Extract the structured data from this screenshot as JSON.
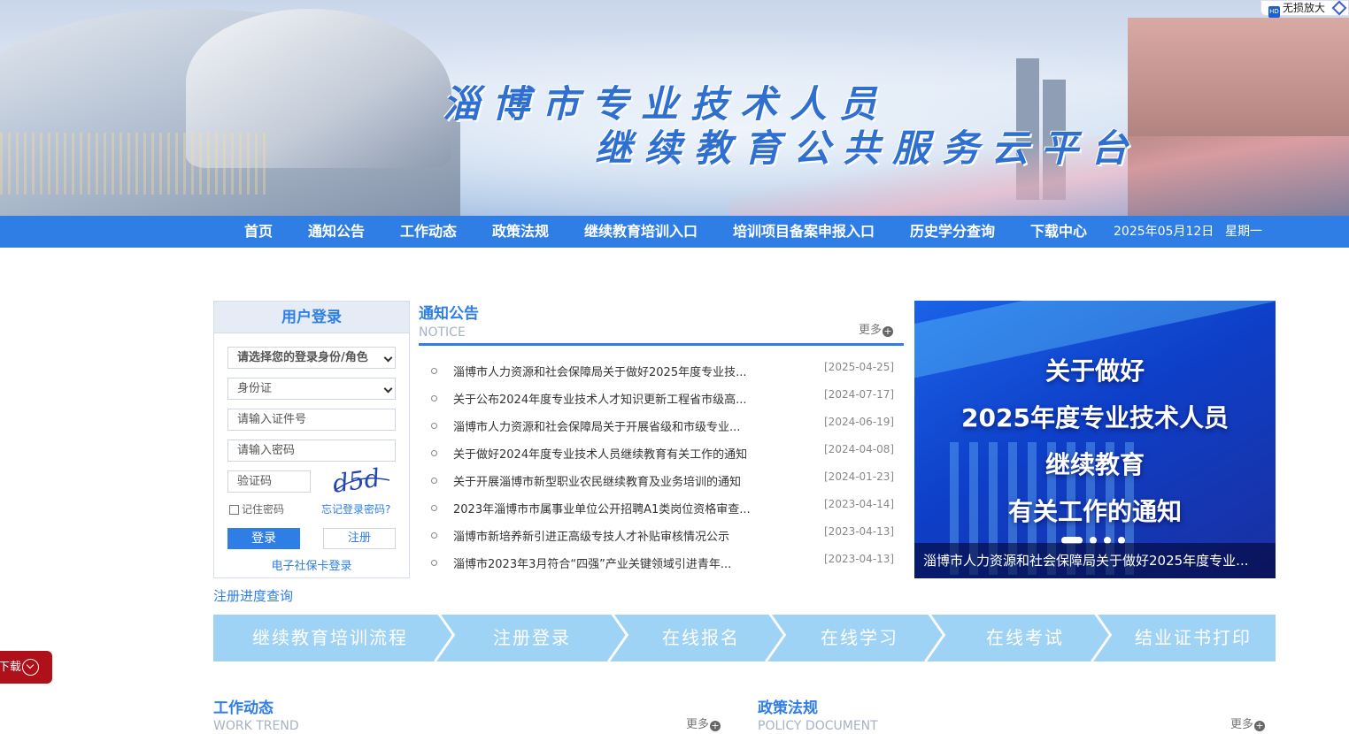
{
  "banner": {
    "title_line1": "淄博市专业技术人员",
    "title_line2": "继续教育公共服务云平台"
  },
  "browser_chip": {
    "icon": "hd-zoom-icon",
    "label": "无损放大"
  },
  "nav": {
    "items": [
      "首页",
      "通知公告",
      "工作动态",
      "政策法规",
      "继续教育培训入口",
      "培训项目备案申报入口",
      "历史学分查询",
      "下载中心"
    ],
    "date": "2025年05月12日",
    "weekday": "星期一"
  },
  "login": {
    "title": "用户登录",
    "role_select": "请选择您的登录身份/角色",
    "id_type_select": "身份证",
    "id_placeholder": "请输入证件号",
    "password_placeholder": "请输入密码",
    "captcha_placeholder": "验证码",
    "captcha_text": "d5d",
    "remember": "记住密码",
    "forgot": "忘记登录密码?",
    "login_button": "登录",
    "register_button": "注册",
    "ecard_login": "电子社保卡登录"
  },
  "register_progress": "注册进度查询",
  "notice": {
    "title": "通知公告",
    "subtitle": "NOTICE",
    "more": "更多",
    "items": [
      {
        "text": "淄博市人力资源和社会保障局关于做好2025年度专业技...",
        "date": "[2025-04-25]"
      },
      {
        "text": "关于公布2024年度专业技术人才知识更新工程省市级高...",
        "date": "[2024-07-17]"
      },
      {
        "text": "淄博市人力资源和社会保障局关于开展省级和市级专业...",
        "date": "[2024-06-19]"
      },
      {
        "text": "关于做好2024年度专业技术人员继续教育有关工作的通知",
        "date": "[2024-04-08]"
      },
      {
        "text": "关于开展淄博市新型职业农民继续教育及业务培训的通知",
        "date": "[2024-01-23]"
      },
      {
        "text": "2023年淄博市市属事业单位公开招聘A1类岗位资格审查...",
        "date": "[2023-04-14]"
      },
      {
        "text": "淄博市新培养新引进正高级专技人才补贴审核情况公示",
        "date": "[2023-04-13]"
      },
      {
        "text": "淄博市2023年3月符合“四强”产业关键领域引进青年...",
        "date": "[2023-04-13]"
      }
    ]
  },
  "slider": {
    "lines": [
      "关于做好",
      "2025年度专业技术人员",
      "继续教育",
      "有关工作的通知"
    ],
    "caption": "淄博市人力资源和社会保障局关于做好2025年度专业...",
    "slide_count": 4,
    "active_slide": 1
  },
  "process": {
    "steps": [
      "继续教育培训流程",
      "注册登录",
      "在线报名",
      "在线学习",
      "在线考试",
      "结业证书打印"
    ]
  },
  "work_trend": {
    "title": "工作动态",
    "subtitle": "WORK TREND",
    "more": "更多"
  },
  "policy": {
    "title": "政策法规",
    "subtitle": "POLICY DOCUMENT",
    "more": "更多"
  },
  "float_tab": {
    "label": "下载"
  }
}
